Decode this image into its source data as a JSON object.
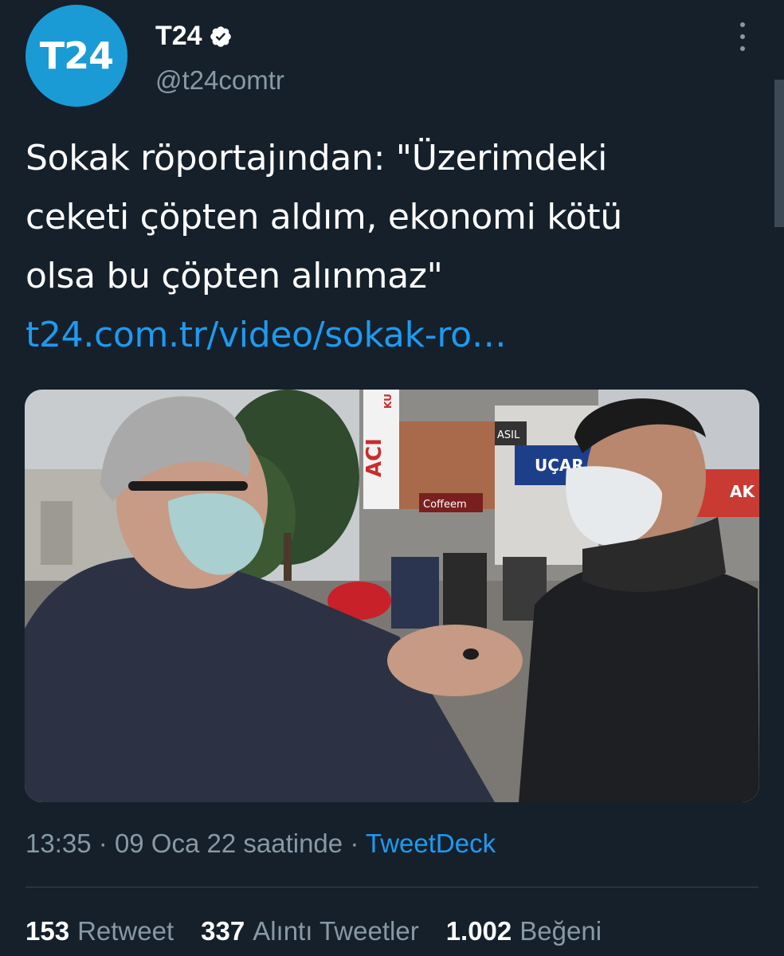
{
  "user": {
    "avatar_text": "T24",
    "name": "T24",
    "handle": "@t24comtr",
    "verified": true
  },
  "tweet": {
    "lines": [
      "Sokak röportajından: \"Üzerimdeki",
      "ceketi çöpten aldım, ekonomi kötü",
      "olsa bu çöpten alınmaz\""
    ],
    "link": "t24.com.tr/video/sokak-ro…"
  },
  "media": {
    "signs": {
      "aci": "ACI",
      "ku": "KU",
      "ucar": "UÇAR",
      "asil": "ASIL",
      "coffeem": "Coffeem",
      "ak": "AK"
    }
  },
  "meta": {
    "time": "13:35",
    "date": "09 Oca 22 saatinde",
    "separator": "·",
    "source": "TweetDeck"
  },
  "stats": [
    {
      "count": "153",
      "label": "Retweet"
    },
    {
      "count": "337",
      "label": "Alıntı Tweetler"
    },
    {
      "count": "1.002",
      "label": "Beğeni"
    }
  ],
  "colors": {
    "background": "#15202b",
    "accent": "#1d9bf0",
    "secondary_text": "#8899a6",
    "avatar_bg": "#1b9bd6"
  },
  "icons": {
    "verified": "verified-badge-icon",
    "more": "more-options-icon"
  }
}
